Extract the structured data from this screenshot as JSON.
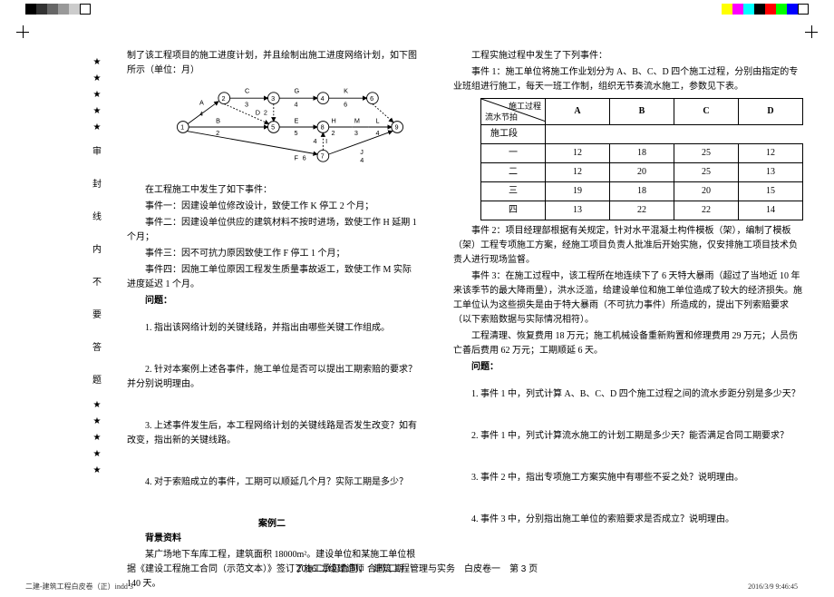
{
  "colorbar_left": [
    "#000",
    "#333",
    "#666",
    "#999",
    "#ccc",
    "#fff"
  ],
  "colorbar_right": [
    "#ff0",
    "#f0f",
    "#0ff",
    "#000",
    "#f00",
    "#0f0",
    "#00f",
    "#fff"
  ],
  "sidebar_chars": [
    "审",
    "封",
    "线",
    "内",
    "不",
    "要",
    "答",
    "题"
  ],
  "left": {
    "intro": "制了该工程项目的施工进度计划，并且绘制出施工进度网络计划，如下图所示（单位：月）",
    "diagram": {
      "nodes": [
        "1",
        "2",
        "3",
        "4",
        "5",
        "6",
        "7",
        "8",
        "9"
      ],
      "acts": [
        {
          "l": "A",
          "d": "4"
        },
        {
          "l": "C",
          "d": "3"
        },
        {
          "l": "G",
          "d": "4"
        },
        {
          "l": "K",
          "d": "6"
        },
        {
          "l": "B",
          "d": "2"
        },
        {
          "l": "D",
          "d": "2"
        },
        {
          "l": "E",
          "d": "5"
        },
        {
          "l": "H",
          "d": "2"
        },
        {
          "l": "M",
          "d": "3"
        },
        {
          "l": "L",
          "d": "4"
        },
        {
          "l": "F",
          "d": "6"
        },
        {
          "l": "I",
          "d": "4"
        },
        {
          "l": "J",
          "d": "4"
        }
      ]
    },
    "events_head": "在工程施工中发生了如下事件：",
    "events": [
      "事件一：因建设单位修改设计，致使工作 K 停工 2 个月；",
      "事件二：因建设单位供应的建筑材料不按时进场，致使工作 H 延期 1 个月；",
      "事件三：因不可抗力原因致使工作 F 停工 1 个月；",
      "事件四：因施工单位原因工程发生质量事故返工，致使工作 M 实际进度延迟 1 个月。"
    ],
    "wt": "问题：",
    "q1": "1. 指出该网络计划的关键线路，并指出由哪些关键工作组成。",
    "q2": "2. 针对本案例上述各事件，施工单位是否可以提出工期索赔的要求？并分别说明理由。",
    "q3": "3. 上述事件发生后，本工程网络计划的关键线路是否发生改变？如有改变，指出新的关键线路。",
    "q4": "4. 对于索赔成立的事件，工期可以顺延几个月？实际工期是多少？",
    "case2": "案例二",
    "bg": "背景资料",
    "bg_text": "某广场地下车库工程，建筑面积 18000m²。建设单位和某施工单位根据《建设工程施工合同（示范文本）》签订了施工承包合同，合同工期 140 天。"
  },
  "right": {
    "intro": "工程实施过程中发生了下列事件：",
    "ev1": "事件 1：施工单位将施工作业划分为 A、B、C、D 四个施工过程，分别由指定的专业班组进行施工，每天一班工作制，组织无节奏流水施工，参数见下表。",
    "table": {
      "head_up": "施工过程",
      "head_dn": "流水节拍",
      "rowlabel": "施工段",
      "cols": [
        "A",
        "B",
        "C",
        "D"
      ],
      "rows": [
        {
          "n": "一",
          "v": [
            "12",
            "18",
            "25",
            "12"
          ]
        },
        {
          "n": "二",
          "v": [
            "12",
            "20",
            "25",
            "13"
          ]
        },
        {
          "n": "三",
          "v": [
            "19",
            "18",
            "20",
            "15"
          ]
        },
        {
          "n": "四",
          "v": [
            "13",
            "22",
            "22",
            "14"
          ]
        }
      ]
    },
    "ev2": "事件 2：项目经理部根据有关规定，针对水平混凝土构件模板（架），编制了模板（架）工程专项施工方案，经施工项目负责人批准后开始实施，仅安排施工项目技术负责人进行现场监督。",
    "ev3": "事件 3：在施工过程中，该工程所在地连续下了 6 天特大暴雨（超过了当地近 10 年来该季节的最大降雨量），洪水泛滥，给建设单位和施工单位造成了较大的经济损失。施工单位认为这些损失是由于特大暴雨（不可抗力事件）所造成的，提出下列索赔要求（以下索赔数据与实际情况相符）。",
    "ev3b": "工程清理、恢复费用 18 万元；施工机械设备重新购置和修理费用 29 万元；人员伤亡善后费用 62 万元；工期顺延 6 天。",
    "wt": "问题：",
    "q1": "1. 事件 1 中，列式计算 A、B、C、D 四个施工过程之间的流水步距分别是多少天？",
    "q2": "2. 事件 1 中，列式计算流水施工的计划工期是多少天？能否满足合同工期要求？",
    "q3": "3. 事件 2 中，指出专项施工方案实施中有哪些不妥之处？说明理由。",
    "q4": "4. 事件 3 中，分别指出施工单位的索赔要求是否成立？说明理由。"
  },
  "footer": "2016 二级建造师　建筑工程管理与实务　白皮卷一　第 3 页",
  "spine": "二建-建筑工程白皮卷（正）indd  3",
  "spine_date": "2016/3/9   9:46:45"
}
